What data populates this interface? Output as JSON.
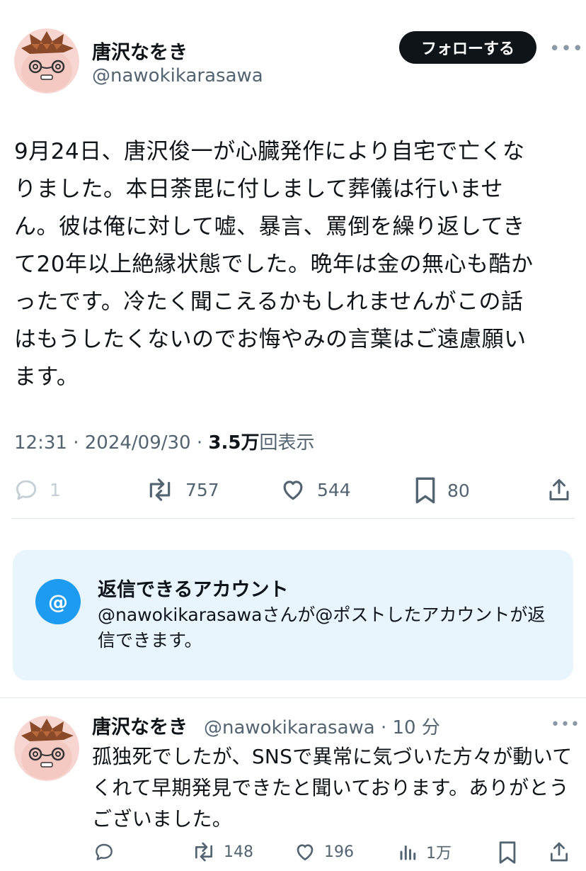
{
  "tweet": {
    "author_name": "唐沢なをき",
    "author_handle": "@nawokikarasawa",
    "follow_label": "フォローする",
    "more_label": "•••",
    "text": "9月24日、唐沢俊一が心臓発作により自宅で亡くな\nりました。本日荼毘に付しまして葬儀は行いませ\nん。彼は俺に対して嘘、暴言、罵倒を繰り返してき\nて20年以上絶縁状態でした。晩年は金の無心も酷か\nったです。冷たく聞こえるかもしれませんがこの話\nはもうしたくないのでお悔やみの言葉はご遠慮願い\nます。",
    "time": "12:31",
    "sep": "·",
    "date": "2024/09/30",
    "views_count": "3.5万",
    "views_label": "回表示",
    "stats": {
      "replies": "1",
      "retweets": "757",
      "likes": "544",
      "bookmarks": "80"
    }
  },
  "reply_restriction": {
    "icon": "@",
    "title": "返信できるアカウント",
    "description": "@nawokikarasawaさんが@ポストしたアカウントが返信できます。"
  },
  "reply": {
    "author_name": "唐沢なをき",
    "handle_time": "@nawokikarasawa · 10 分",
    "more_label": "•••",
    "text": "孤独死でしたが、SNSで異常に気づいた方々が動いてくれて早期発見できたと聞いております。ありがとうございました。",
    "stats": {
      "retweets": "148",
      "likes": "196",
      "views": "1万"
    }
  },
  "icons": {
    "reply": "reply-icon",
    "retweet": "retweet-icon",
    "like": "heart-icon",
    "bookmark": "bookmark-icon",
    "share": "share-icon",
    "views": "views-icon"
  },
  "colors": {
    "text": "#0f1419",
    "secondary": "#536471",
    "accent": "#1d9bf0",
    "reply_box_bg": "#e8f5fd",
    "follow_bg": "#0f1419"
  }
}
